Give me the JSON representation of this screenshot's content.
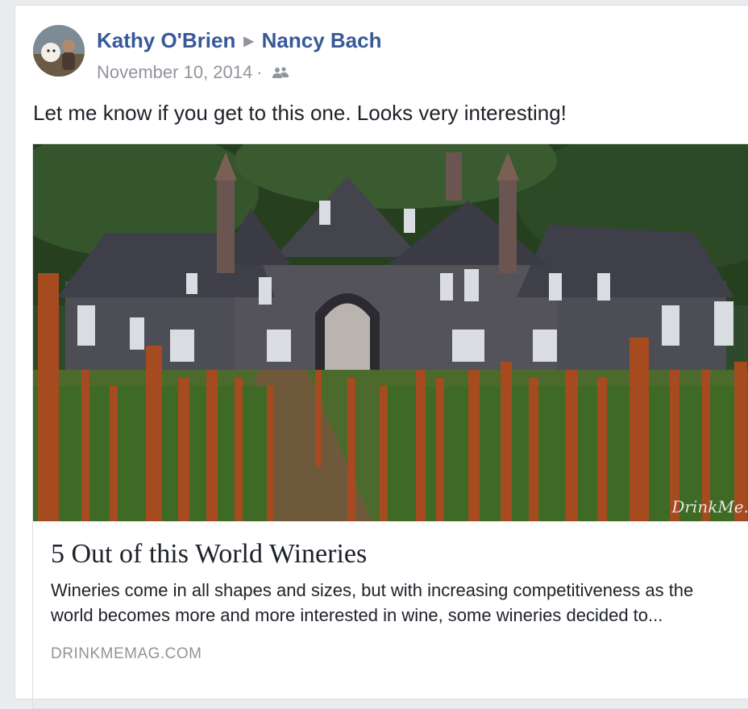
{
  "post": {
    "author": "Kathy O'Brien",
    "separator_icon": "right-triangle-icon",
    "recipient": "Nancy Bach",
    "date": "November 10, 2014",
    "dot": "·",
    "audience_icon": "friends-icon",
    "text": "Let me know if you get to this one. Looks very interesting!"
  },
  "link": {
    "image_watermark": "DrinkMe.",
    "title": "5 Out of this World Wineries",
    "description": "Wineries come in all shapes and sizes, but with increasing competitiveness as the world becomes more and more interested in wine, some wineries decided to...",
    "domain": "DRINKMEMAG.COM"
  },
  "colors": {
    "link_blue": "#385898",
    "meta_gray": "#90949c",
    "text": "#1d2129"
  }
}
